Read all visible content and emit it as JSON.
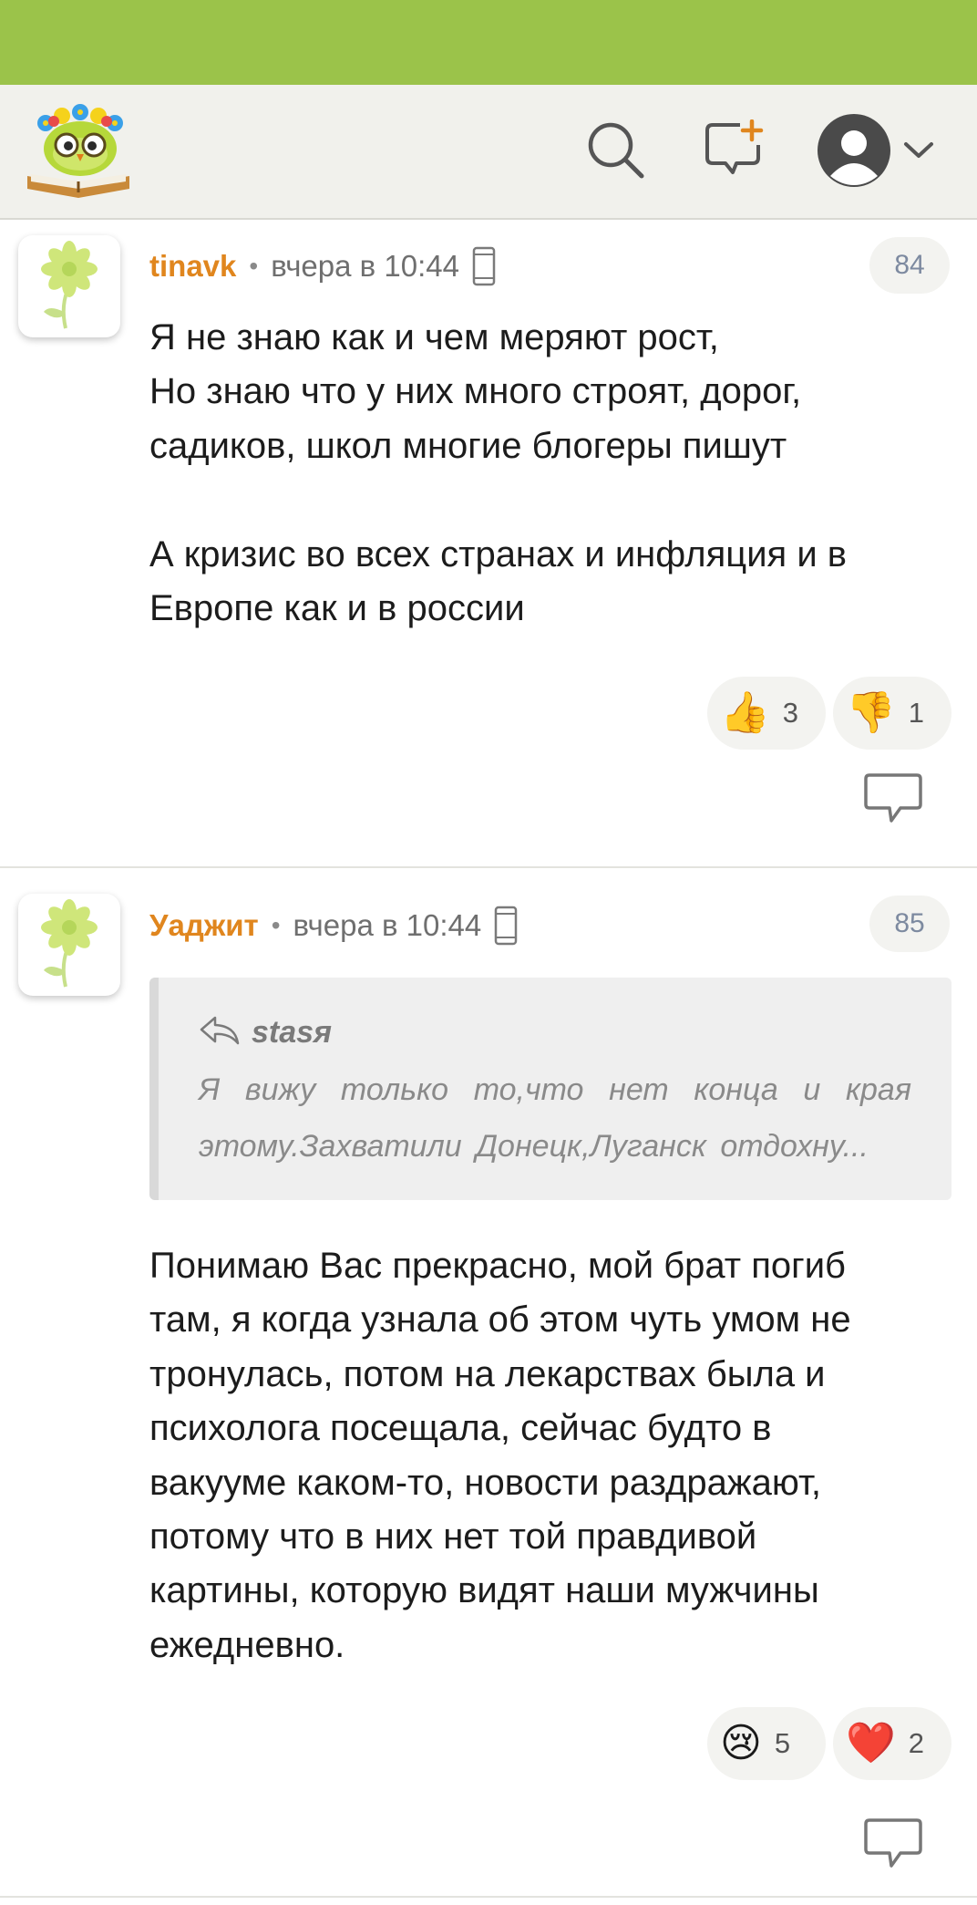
{
  "header": {
    "logo_icon": "owl-with-flowers-on-book-logo",
    "search_icon": "search-icon",
    "new_post_icon": "new-post-icon",
    "profile_icon": "user-avatar-icon",
    "menu_icon": "chevron-down-icon"
  },
  "colors": {
    "status_bar": "#9bc34a",
    "header_bg": "#f1f1ec",
    "author": "#e0861e",
    "badge_text": "#7d8aa0"
  },
  "comments": [
    {
      "author": "tinavk",
      "separator": "•",
      "time": "вчера в 10:44",
      "device_icon": "phone-icon",
      "number": "84",
      "lines": [
        "Я не знаю как и чем меряют рост,",
        "Но знаю что у них много строят, дорог,",
        "садиков, школ многие блогеры пишут",
        "",
        "А кризис во всех странах и инфляция и в",
        "Европе как и в россии"
      ],
      "reactions": [
        {
          "emoji": "👍",
          "icon": "thumbs-up-icon",
          "count": "3"
        },
        {
          "emoji": "👎",
          "icon": "thumbs-down-icon",
          "count": "1"
        }
      ],
      "reply_icon": "reply-bubble-icon"
    },
    {
      "author": "Уаджит",
      "separator": "•",
      "time": "вчера в 10:44",
      "device_icon": "phone-icon",
      "number": "85",
      "quote": {
        "icon": "reply-arrow-icon",
        "author": "stasя",
        "lines": [
          "Я вижу только то,что нет конца и края",
          "этому.Захватили Донецк,Луганск отдохну..."
        ]
      },
      "lines": [
        "Понимаю Вас прекрасно, мой брат погиб",
        "там, я когда узнала об этом чуть умом не",
        "тронулась, потом на лекарствах была и",
        "психолога посещала, сейчас будто в",
        "вакууме каком-то, новости раздражают,",
        "потому что в них нет той правдивой",
        "картины, которую видят наши мужчины",
        "ежедневно."
      ],
      "reactions": [
        {
          "emoji": "😢",
          "icon": "crying-face-icon",
          "count": "5"
        },
        {
          "emoji": "❤️",
          "icon": "heart-icon",
          "count": "2"
        }
      ],
      "reply_icon": "reply-bubble-icon"
    }
  ]
}
